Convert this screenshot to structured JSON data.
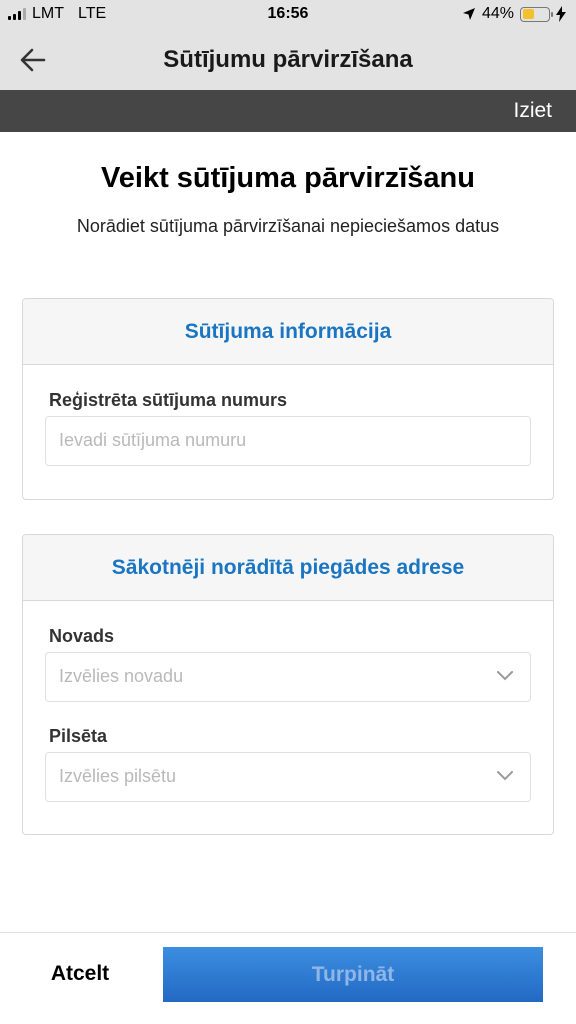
{
  "status_bar": {
    "carrier": "LMT",
    "network": "LTE",
    "time": "16:56",
    "battery_percent": "44%",
    "battery_level": 0.44
  },
  "nav": {
    "title": "Sūtījumu pārvirzīšana",
    "back_icon": "arrow-left-icon"
  },
  "top_bar": {
    "logout_label": "Iziet"
  },
  "page": {
    "heading": "Veikt sūtījuma pārvirzīšanu",
    "subheading": "Norādiet sūtījuma pārvirzīšanai nepieciešamos datus"
  },
  "shipment_info": {
    "title": "Sūtījuma informācija",
    "tracking_label": "Reģistrēta sūtījuma numurs",
    "tracking_placeholder": "Ievadi sūtījuma numuru"
  },
  "original_address": {
    "title": "Sākotnēji norādītā piegādes adrese",
    "region_label": "Novads",
    "region_placeholder": "Izvēlies novadu",
    "city_label": "Pilsēta",
    "city_placeholder": "Izvēlies pilsētu"
  },
  "actions": {
    "cancel_label": "Atcelt",
    "continue_label": "Turpināt"
  },
  "colors": {
    "accent_blue": "#1a76c2",
    "button_blue": "#2d7bd4",
    "dark_bar": "#464646",
    "header_gray": "#e3e3e3",
    "battery_yellow": "#f3c22a"
  }
}
